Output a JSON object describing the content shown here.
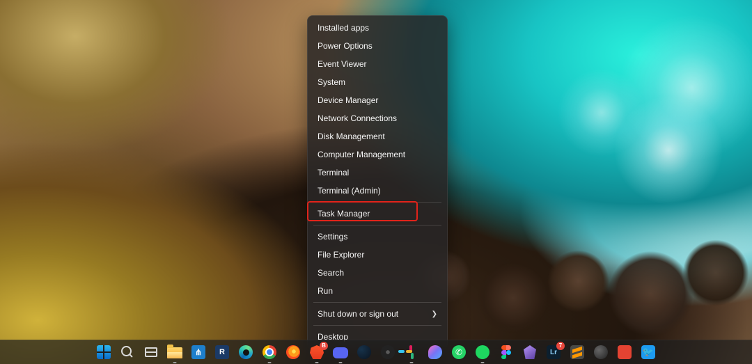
{
  "contextMenu": {
    "items": [
      {
        "label": "Installed apps",
        "submenu": false
      },
      {
        "label": "Power Options",
        "submenu": false
      },
      {
        "label": "Event Viewer",
        "submenu": false
      },
      {
        "label": "System",
        "submenu": false
      },
      {
        "label": "Device Manager",
        "submenu": false
      },
      {
        "label": "Network Connections",
        "submenu": false
      },
      {
        "label": "Disk Management",
        "submenu": false
      },
      {
        "label": "Computer Management",
        "submenu": false
      },
      {
        "label": "Terminal",
        "submenu": false
      },
      {
        "label": "Terminal (Admin)",
        "submenu": false
      },
      {
        "label": "Task Manager",
        "submenu": false
      },
      {
        "label": "Settings",
        "submenu": false
      },
      {
        "label": "File Explorer",
        "submenu": false
      },
      {
        "label": "Search",
        "submenu": false
      },
      {
        "label": "Run",
        "submenu": false
      },
      {
        "label": "Shut down or sign out",
        "submenu": true
      },
      {
        "label": "Desktop",
        "submenu": false
      }
    ],
    "highlighted_index": 10
  },
  "highlight": {
    "label": "Task Manager",
    "color": "#e2231a"
  },
  "taskbar": {
    "items": [
      {
        "name": "start-button",
        "icon": "start",
        "active": false
      },
      {
        "name": "search-button",
        "icon": "search",
        "active": false
      },
      {
        "name": "task-view-button",
        "icon": "taskview",
        "active": false
      },
      {
        "name": "file-explorer",
        "icon": "explorer",
        "active": true
      },
      {
        "name": "vscode",
        "icon": "vscode",
        "active": false
      },
      {
        "name": "revit",
        "icon": "revit",
        "active": false
      },
      {
        "name": "microsoft-edge",
        "icon": "edge",
        "active": false
      },
      {
        "name": "google-chrome",
        "icon": "chrome",
        "active": true
      },
      {
        "name": "mozilla-firefox",
        "icon": "firefox",
        "active": false
      },
      {
        "name": "brave-browser",
        "icon": "brave",
        "active": true,
        "badge": "B"
      },
      {
        "name": "discord",
        "icon": "discord",
        "active": true
      },
      {
        "name": "steam",
        "icon": "steam",
        "active": false
      },
      {
        "name": "obs-studio",
        "icon": "obs",
        "active": false
      },
      {
        "name": "slack",
        "icon": "slack",
        "active": true
      },
      {
        "name": "messenger",
        "icon": "messenger",
        "active": false
      },
      {
        "name": "whatsapp",
        "icon": "whatsapp",
        "active": false
      },
      {
        "name": "spotify",
        "icon": "spotify",
        "active": true
      },
      {
        "name": "figma",
        "icon": "figma",
        "active": false
      },
      {
        "name": "obsidian",
        "icon": "obsidian",
        "active": false
      },
      {
        "name": "lightroom",
        "icon": "lightroom",
        "active": false,
        "badge": "7"
      },
      {
        "name": "sublime-text",
        "icon": "sublime",
        "active": false
      },
      {
        "name": "unknown-app",
        "icon": "generic",
        "active": false
      },
      {
        "name": "todoist",
        "icon": "todoist",
        "active": false
      },
      {
        "name": "twitter",
        "icon": "twitter",
        "active": false
      }
    ]
  }
}
